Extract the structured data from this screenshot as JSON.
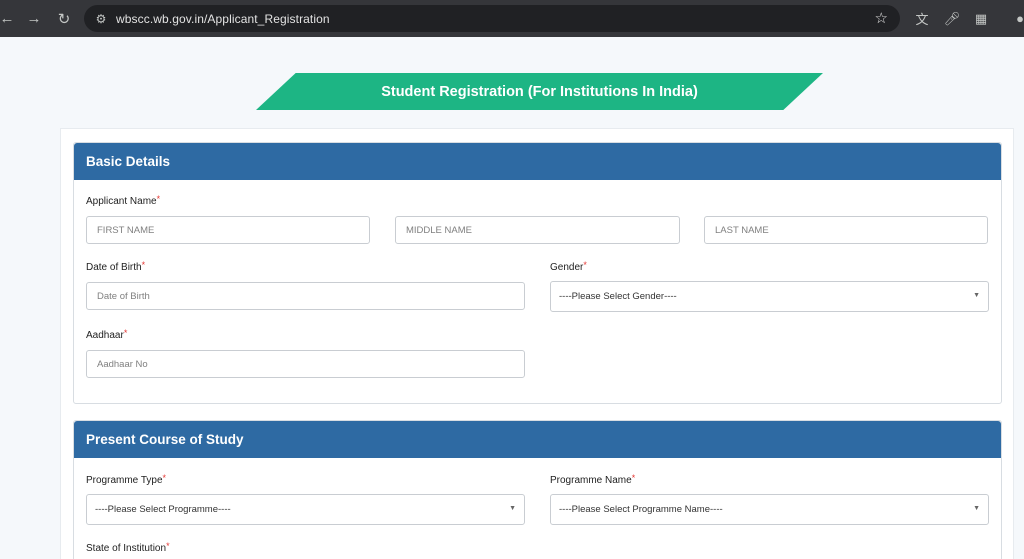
{
  "browser": {
    "url": "wbscc.wb.gov.in/Applicant_Registration",
    "icons": [
      "back-arrow-icon",
      "forward-arrow-icon",
      "reload-icon",
      "site-info-icon",
      "bookmark-star-icon",
      "translate-icon",
      "microphone-icon",
      "extensions-icon",
      "profile-icon"
    ]
  },
  "page": {
    "title": "Student Registration (For Institutions In India)"
  },
  "colors": {
    "banner": "#1db584",
    "section_header": "#2e6aa3",
    "required": "#e53935"
  },
  "basic_details": {
    "heading": "Basic Details",
    "applicant_name_label": "Applicant Name",
    "first_name_placeholder": "FIRST NAME",
    "middle_name_placeholder": "MIDDLE NAME",
    "last_name_placeholder": "LAST NAME",
    "dob_label": "Date of Birth",
    "dob_placeholder": "Date of Birth",
    "gender_label": "Gender",
    "gender_value": "----Please Select Gender----",
    "aadhaar_label": "Aadhaar",
    "aadhaar_placeholder": "Aadhaar No"
  },
  "course": {
    "heading": "Present Course of Study",
    "programme_type_label": "Programme Type",
    "programme_type_value": "----Please Select Programme----",
    "programme_name_label": "Programme Name",
    "programme_name_value": "----Please Select Programme Name----",
    "state_label": "State of Institution"
  },
  "required_marker": "*"
}
